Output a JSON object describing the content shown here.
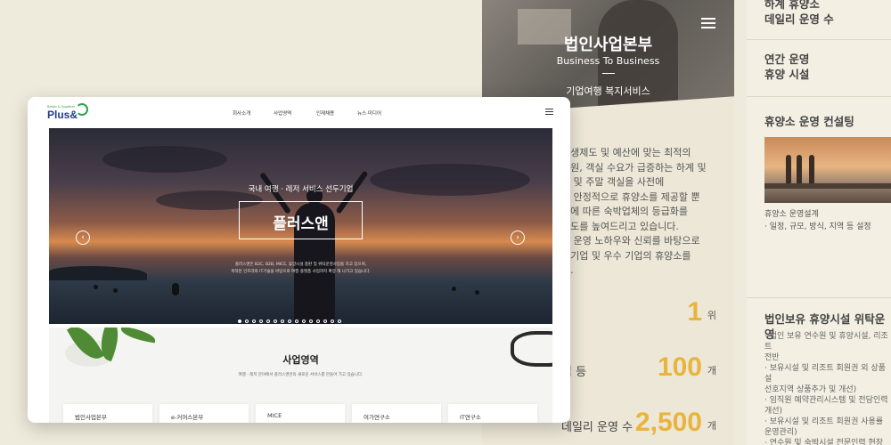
{
  "mobile_panel": {
    "title": "법인사업본부",
    "subtitle": "Business To Business",
    "dash": "–",
    "description": "기업여행 복지서비스",
    "paragraph_lines": [
      "후생제도 및 예산에 맞는 최적의",
      "지원, 객실 수요가 급증하는 하계 및",
      "기 및 주말 객실을 사전에",
      "다 안정적으로 휴양소를 제공할 뿐",
      "도에 따른 숙박업체의 등급화를",
      "족도를 높여드리고 있습니다.",
      "소 운영 노하우와 신뢰를 바탕으로",
      "공기업 및 우수 기업의 휴양소를",
      "다."
    ],
    "stats": [
      {
        "label": "",
        "value": "1",
        "unit": "위"
      },
      {
        "label": "업 등",
        "value": "100",
        "unit": "개"
      },
      {
        "label": "데일리 운영 수",
        "value": "2,500",
        "unit": "개"
      }
    ]
  },
  "right_panel": {
    "headings": [
      {
        "lines": [
          "하계 휴양소",
          "데일리 운영 수"
        ]
      },
      {
        "lines": [
          "연간 운영",
          "휴양 시설"
        ]
      },
      {
        "lines": [
          "휴양소 운영 컨설팅"
        ]
      }
    ],
    "consulting_caption": "휴양소 운영설계",
    "consulting_item": "· 일정, 규모, 방식, 지역 등 설정",
    "trust_heading": "법인보유 휴양시설 위탁운영",
    "trust_items": [
      "· 법인 보유 연수원 및 휴양시설, 리조트",
      "  전반",
      "· 보유시설 및 리조트 회원권 외 상품설",
      "  선호지역 상품추가 및 개선)",
      "· 임직원 예약관리시스템 및 전담인력",
      "  개선)",
      "· 보유시설 및 리조트 회원권 사용률",
      "  운영관리)",
      "· 연수원 및 숙박시설 전문인력 현장배"
    ]
  },
  "site": {
    "logo_tagline": "Better & Together",
    "logo_text": "Plus&",
    "nav": [
      "회사소개",
      "사업영역",
      "인재채용",
      "뉴스·미디어"
    ],
    "hero": {
      "kicker": "국내 여행 · 레저 서비스 선두기업",
      "title": "플러스앤",
      "desc_line1": "플러스앤은 B2C, B2B, MICE, 휴양시설 총판 및 위탁운영사업을 하고 있으며,",
      "desc_line2": "축적된 인프라와 IT기술을 바탕으로 여행 플랫폼 사업까지 확장 해 나가고 있습니다.",
      "prev": "‹",
      "next": "›",
      "slide_count": 15,
      "active_slide": 1
    },
    "business": {
      "title": "사업영역",
      "desc": "여행 · 레저 분야에서 플러스앤만의 새로운 서비스를 만들어 가고 있습니다.",
      "tiles": [
        "법인사업본부",
        "e-커머스본부",
        "MICE",
        "여가연구소",
        "IT연구소"
      ]
    }
  },
  "colors": {
    "accent_gold": "#e9b43c",
    "logo_blue": "#1e3c8c",
    "logo_green": "#2ca34a",
    "background": "#efebdc"
  }
}
